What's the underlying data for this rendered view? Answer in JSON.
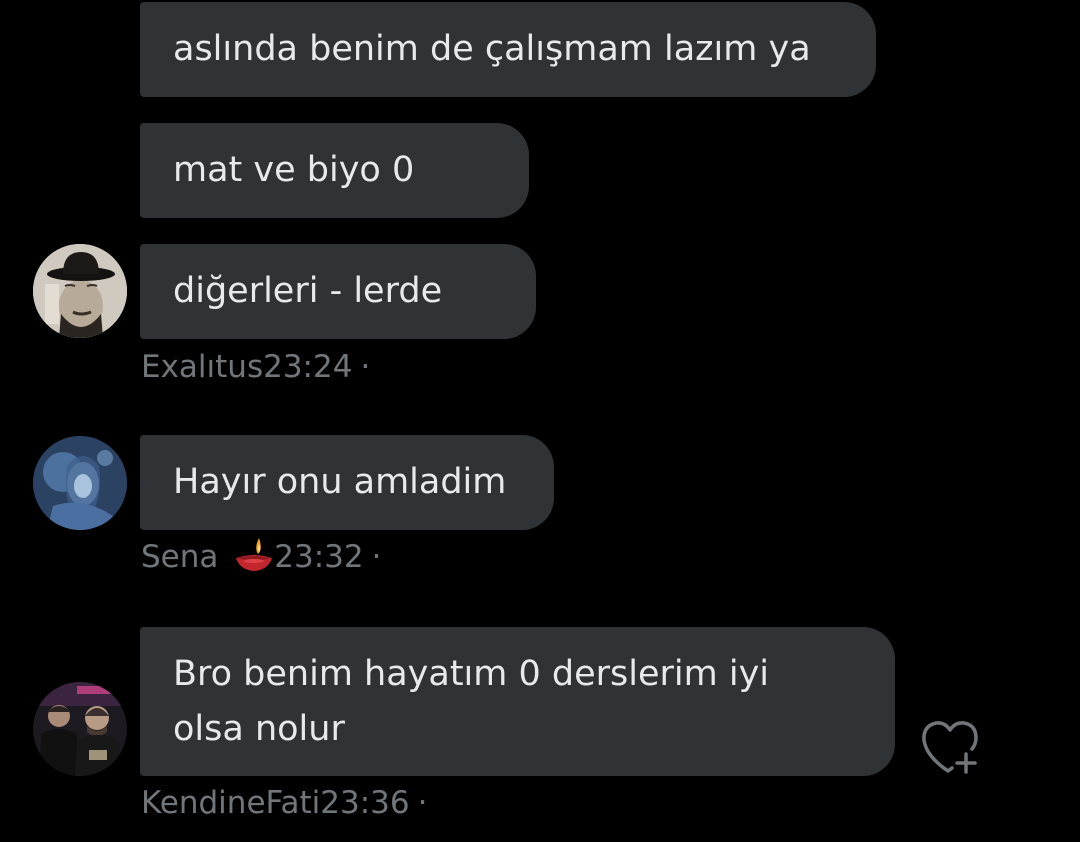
{
  "messages": [
    {
      "text": "aslında benim de çalışmam lazım ya"
    },
    {
      "text": "mat ve biyo 0"
    },
    {
      "text": "diğerleri - lerde"
    },
    {
      "text": "Hayır onu amladim"
    },
    {
      "line1": "Bro benim hayatım 0 derslerim iyi",
      "line2": "olsa nolur"
    }
  ],
  "meta": {
    "exalitus": {
      "name": "Exalıtus",
      "time": "23:24",
      "dot": "·"
    },
    "sena": {
      "name": "Sena",
      "emoji": "diya-lamp-icon",
      "time": "23:32",
      "dot": "·"
    },
    "kendine": {
      "name": "KendineFati",
      "time": "23:36",
      "dot": "·"
    }
  },
  "colors": {
    "background": "#000000",
    "bubble": "#2f3336",
    "text": "#e7e9ea",
    "meta": "#71767b"
  }
}
